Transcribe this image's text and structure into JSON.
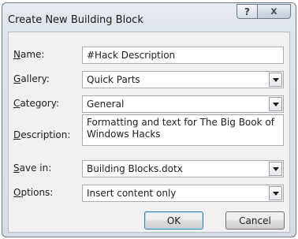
{
  "window": {
    "title": "Create New Building Block",
    "help_glyph": "?",
    "close_glyph": "x"
  },
  "form": {
    "name": {
      "mnemonic": "N",
      "label_rest": "ame:",
      "value": "#Hack Description"
    },
    "gallery": {
      "mnemonic": "G",
      "label_rest": "allery:",
      "value": "Quick Parts"
    },
    "category": {
      "mnemonic": "C",
      "label_rest": "ategory:",
      "value": "General"
    },
    "description": {
      "mnemonic": "D",
      "label_rest": "escription:",
      "value": "Formatting and text for The Big Book of Windows Hacks"
    },
    "save_in": {
      "mnemonic": "S",
      "label_rest": "ave in:",
      "value": "Building Blocks.dotx"
    },
    "options": {
      "mnemonic": "O",
      "label_rest": "ptions:",
      "value": "Insert content only"
    }
  },
  "buttons": {
    "ok": "OK",
    "cancel": "Cancel"
  }
}
